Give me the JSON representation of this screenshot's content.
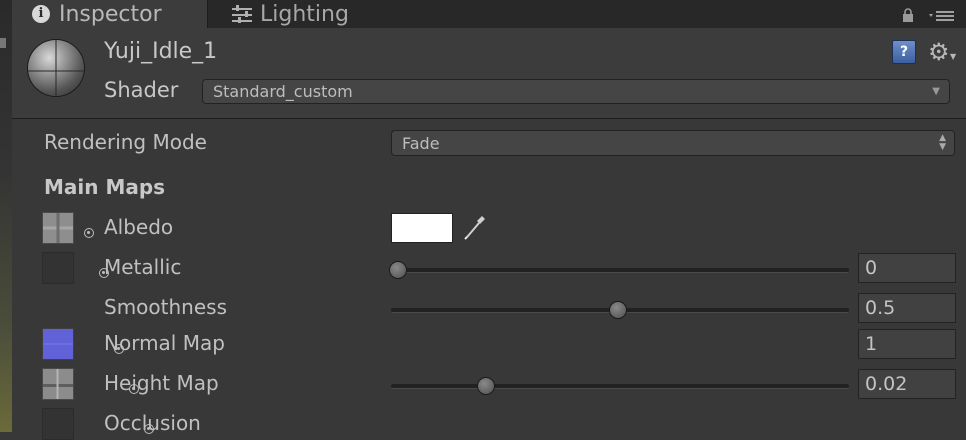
{
  "tabs": {
    "inspector": "Inspector",
    "lighting": "Lighting"
  },
  "material": {
    "name": "Yuji_Idle_1",
    "shader_label": "Shader",
    "shader_value": "Standard_custom"
  },
  "rendering_mode": {
    "label": "Rendering Mode",
    "value": "Fade"
  },
  "main_maps": {
    "heading": "Main Maps",
    "albedo": {
      "label": "Albedo",
      "color": "#ffffff"
    },
    "metallic": {
      "label": "Metallic",
      "value": "0",
      "slider_fraction": 0.0
    },
    "smoothness": {
      "label": "Smoothness",
      "value": "0.5",
      "slider_fraction": 0.5
    },
    "normal_map": {
      "label": "Normal Map",
      "value": "1"
    },
    "height_map": {
      "label": "Height Map",
      "value": "0.02",
      "slider_fraction": 0.2
    },
    "occlusion": {
      "label": "Occlusion"
    }
  },
  "icons": {
    "info": "i",
    "help": "?"
  }
}
